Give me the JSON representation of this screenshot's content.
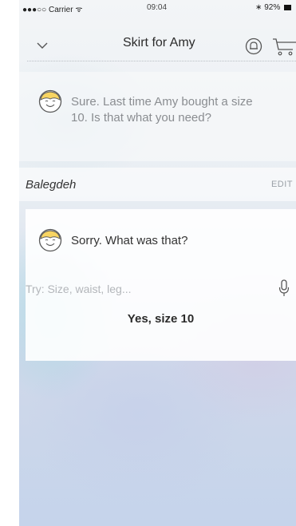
{
  "status": {
    "carrier": "●●●○○ Carrier ᯤ",
    "time": "09:04",
    "battery": "∗ 92%"
  },
  "nav": {
    "title": "Skirt for Amy"
  },
  "assistant_message": "Sure. Last time Amy bought a size 10. Is that what you need?",
  "user_entry": {
    "text": "Balegdeh",
    "edit_label": "EDIT"
  },
  "assistant_retry": "Sorry. What was that?",
  "input": {
    "placeholder": "Try: Size, waist, leg..."
  },
  "suggestion": "Yes, size 10",
  "colors": {
    "avatar_fill": "#f7d462",
    "avatar_stroke": "#5a5a5a"
  }
}
